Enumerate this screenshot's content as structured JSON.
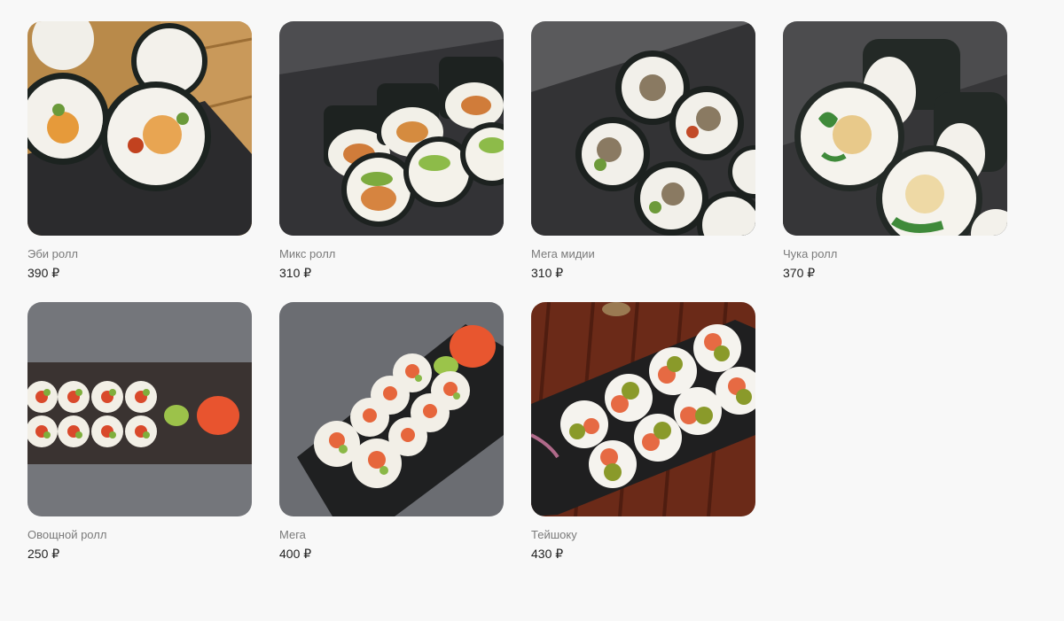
{
  "products": [
    {
      "name": "Эби ролл",
      "price": "390 ₽"
    },
    {
      "name": "Микс ролл",
      "price": "310 ₽"
    },
    {
      "name": "Мега мидии",
      "price": "310 ₽"
    },
    {
      "name": "Чука ролл",
      "price": "370 ₽"
    },
    {
      "name": "Овощной ролл",
      "price": "250 ₽"
    },
    {
      "name": "Мега",
      "price": "400 ₽"
    },
    {
      "name": "Тейшоку",
      "price": "430 ₽"
    }
  ]
}
